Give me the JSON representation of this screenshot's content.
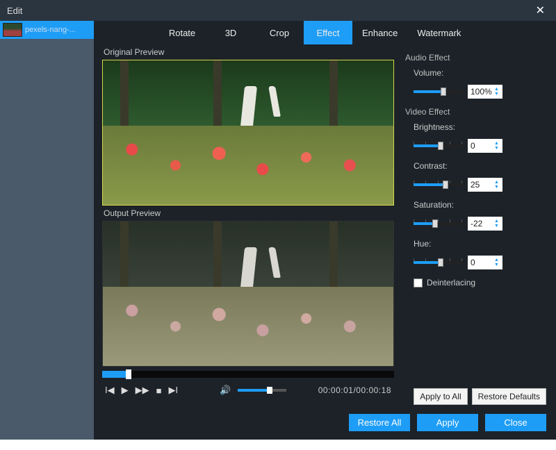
{
  "window": {
    "title": "Edit"
  },
  "sidebar": {
    "items": [
      {
        "filename": "pexels-nang-..."
      }
    ]
  },
  "tabs": [
    {
      "label": "Rotate",
      "active": false
    },
    {
      "label": "3D",
      "active": false
    },
    {
      "label": "Crop",
      "active": false
    },
    {
      "label": "Effect",
      "active": true
    },
    {
      "label": "Enhance",
      "active": false
    },
    {
      "label": "Watermark",
      "active": false
    }
  ],
  "preview": {
    "original_label": "Original Preview",
    "output_label": "Output Preview",
    "timecode": "00:00:01/00:00:18",
    "scrub_percent": 8,
    "volume_percent": 60
  },
  "panel": {
    "audio_section": "Audio Effect",
    "video_section": "Video Effect",
    "volume_label": "Volume:",
    "volume_value": "100%",
    "volume_slider": 55,
    "brightness_label": "Brightness:",
    "brightness_value": "0",
    "brightness_slider": 50,
    "contrast_label": "Contrast:",
    "contrast_value": "25",
    "contrast_slider": 60,
    "saturation_label": "Saturation:",
    "saturation_value": "-22",
    "saturation_slider": 38,
    "hue_label": "Hue:",
    "hue_value": "0",
    "hue_slider": 50,
    "deinterlacing_label": "Deinterlacing",
    "deinterlacing_checked": false
  },
  "buttons": {
    "apply_to_all": "Apply to All",
    "restore_defaults": "Restore Defaults",
    "restore_all": "Restore All",
    "apply": "Apply",
    "close": "Close"
  }
}
